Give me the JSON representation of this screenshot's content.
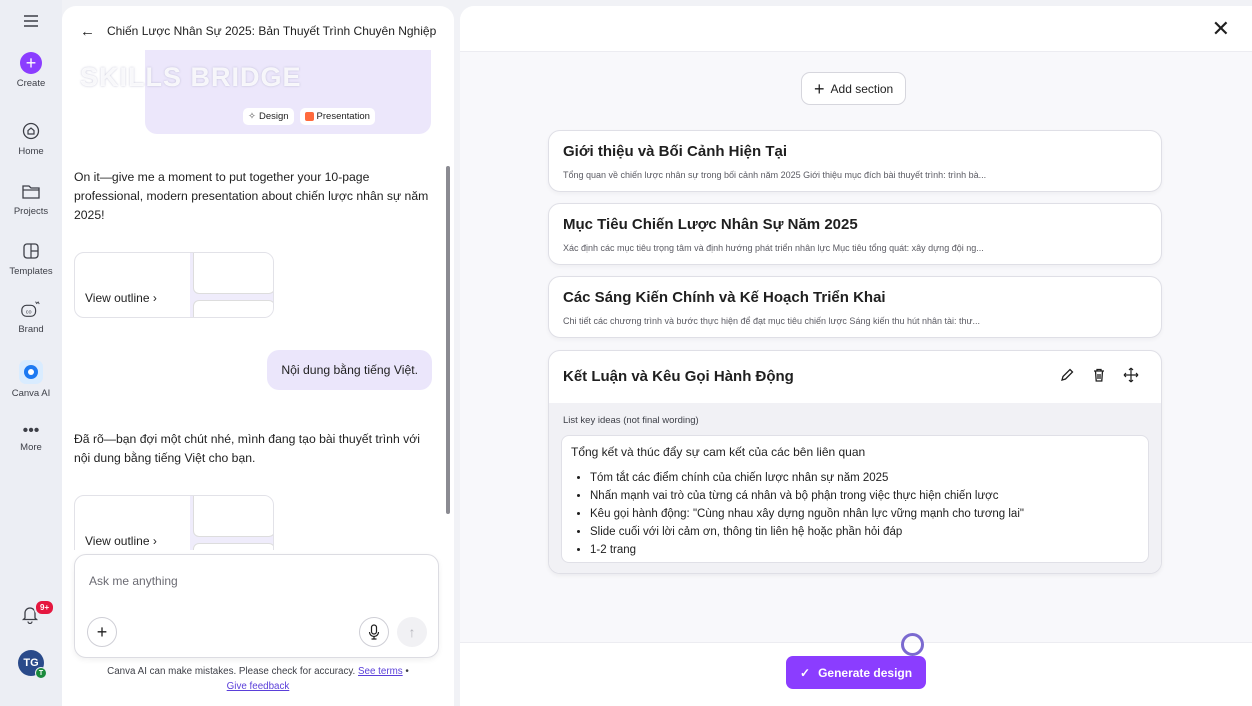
{
  "rail": {
    "create": "Create",
    "home": "Home",
    "projects": "Projects",
    "templates": "Templates",
    "brand": "Brand",
    "canva_ai": "Canva AI",
    "more": "More",
    "notif_count": "9+",
    "avatar_initials": "TG",
    "avatar_sub": "T"
  },
  "chat": {
    "title": "Chiến Lược Nhân Sự 2025: Bản Thuyết Trình Chuyên Nghiệp",
    "watermark": "SKILLS BRIDGE",
    "chip_design": "Design",
    "chip_presentation": "Presentation",
    "msg1": "On it—give me a moment to put together your 10-page professional, modern presentation about chiến lược nhân sự năm 2025!",
    "view_outline": "View outline",
    "user_msg": "Nội dung bằng tiếng Việt.",
    "msg2": "Đã rõ—bạn đợi một chút nhé, mình đang tạo bài thuyết trình với nội dung bằng tiếng Việt cho bạn.",
    "view_outline2": "View outline",
    "ask_placeholder": "Ask me anything",
    "disclaimer": "Canva AI can make mistakes. Please check for accuracy.",
    "see_terms": "See terms",
    "give_feedback": "Give feedback"
  },
  "editor": {
    "add_section": "Add section",
    "sections": [
      {
        "title": "Giới thiệu và Bối Cảnh Hiện Tại",
        "desc": "Tổng quan về chiến lược nhân sự trong bối cảnh năm 2025 Giới thiệu mục đích bài thuyết trình: trình bà..."
      },
      {
        "title": "Mục Tiêu Chiến Lược Nhân Sự Năm 2025",
        "desc": "Xác định các mục tiêu trọng tâm và định hướng phát triển nhân lực Mục tiêu tổng quát: xây dựng đội ng..."
      },
      {
        "title": "Các Sáng Kiến Chính và Kế Hoạch Triển Khai",
        "desc": "Chi tiết các chương trình và bước thực hiện để đạt mục tiêu chiến lược Sáng kiến thu hút nhân tài: thư..."
      }
    ],
    "expanded": {
      "title": "Kết Luận và Kêu Gọi Hành Động",
      "key_label": "List key ideas (not final wording)",
      "lead": "Tổng kết và thúc đẩy sự cam kết của các bên liên quan",
      "bullets": [
        "Tóm tắt các điểm chính của chiến lược nhân sự năm 2025",
        "Nhấn mạnh vai trò của từng cá nhân và bộ phận trong việc thực hiện chiến lược",
        "Kêu gọi hành động: \"Cùng nhau xây dựng nguồn nhân lực vững mạnh cho tương lai\"",
        "Slide cuối với lời cảm ơn, thông tin liên hệ hoặc phần hỏi đáp",
        "1-2 trang"
      ]
    },
    "generate": "Generate design"
  }
}
